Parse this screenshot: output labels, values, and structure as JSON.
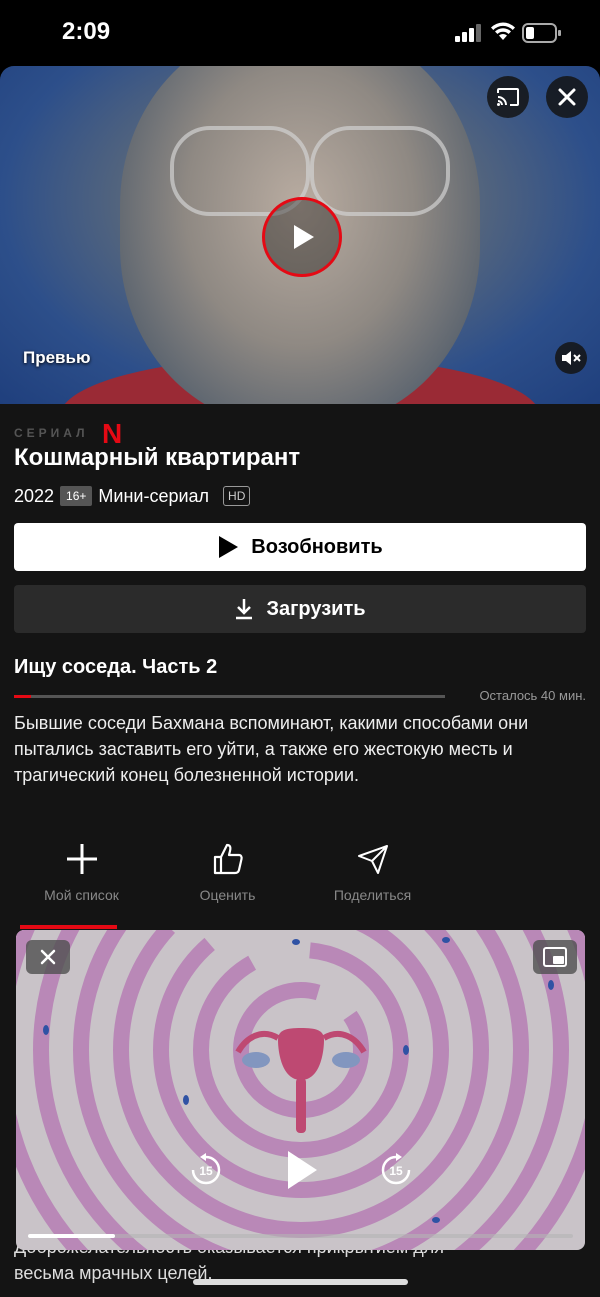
{
  "status": {
    "time": "2:09"
  },
  "hero": {
    "label": "Превью"
  },
  "show": {
    "series_tag": "СЕРИАЛ",
    "brand_letter": "N",
    "title": "Кошмарный квартирант",
    "year": "2022",
    "age_rating": "16+",
    "format": "Мини-сериал",
    "quality": "HD"
  },
  "buttons": {
    "resume": "Возобновить",
    "download": "Загрузить"
  },
  "episode": {
    "title": "Ищу соседа. Часть 2",
    "remaining": "Осталось 40 мин.",
    "progress": 0.04,
    "description": "Бывшие соседи Бахмана вспоминают, какими способами они пытались заставить его уйти, а также его жестокую месть и трагический конец болезненной истории."
  },
  "actions": {
    "my_list": "Мой список",
    "rate": "Оценить",
    "share": "Поделиться"
  },
  "pip": {
    "rewind": "15",
    "forward": "15",
    "progress": 0.16
  },
  "under_text": {
    "line1": "Доброжелательность оказывается прикрытием для",
    "line2": "весьма мрачных целей."
  },
  "colors": {
    "accent": "#e50914",
    "background": "#141414",
    "maze": "#e2a6e0"
  }
}
